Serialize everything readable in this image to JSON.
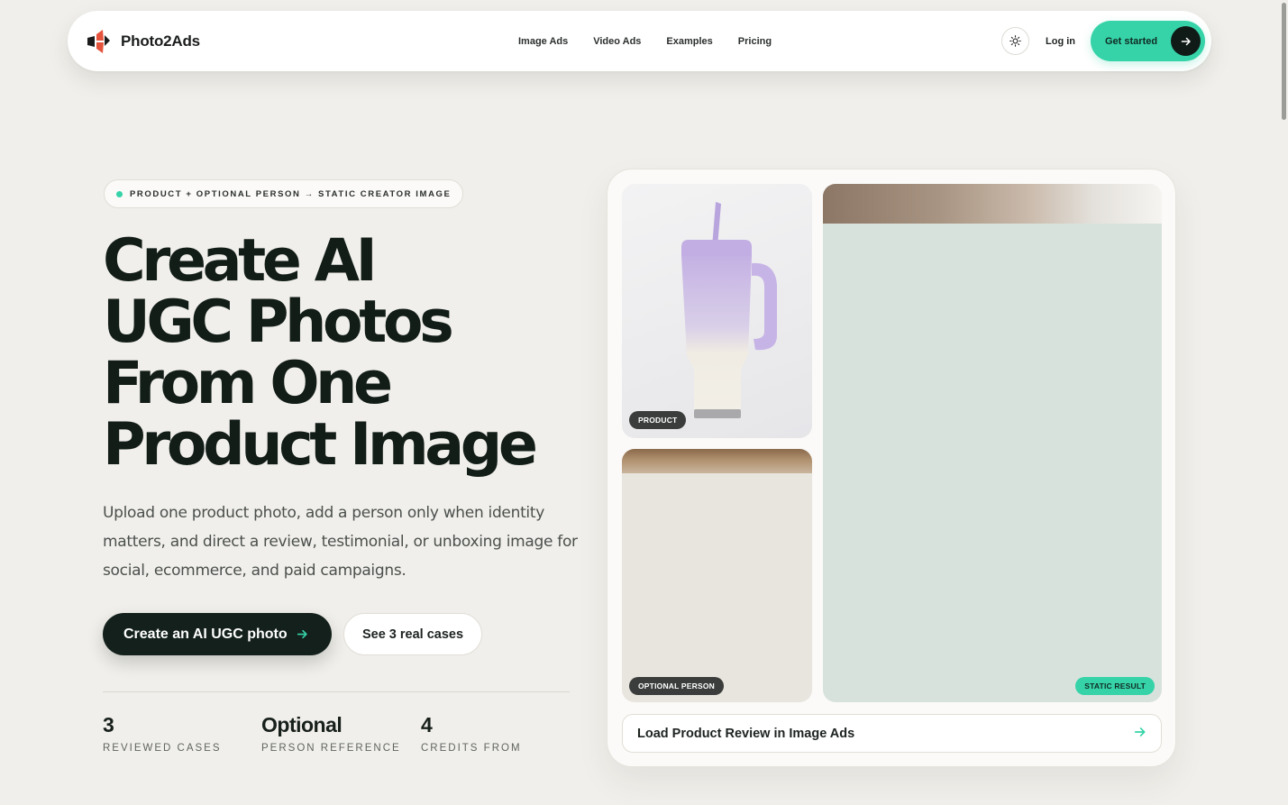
{
  "nav": {
    "brand": "Photo2Ads",
    "links": [
      "Image Ads",
      "Video Ads",
      "Examples",
      "Pricing"
    ],
    "login": "Log in",
    "get_started": "Get started"
  },
  "hero": {
    "eyebrow": "PRODUCT + OPTIONAL PERSON → STATIC CREATOR IMAGE",
    "headline": [
      "Create AI",
      "UGC Photos",
      "From One",
      "Product Image"
    ],
    "subhead": "Upload one product photo, add a person only when identity matters, and direct a review, testimonial, or unboxing image for social, ecommerce, and paid campaigns.",
    "primary_cta": "Create an AI UGC photo",
    "secondary_cta": "See 3 real cases",
    "stats": [
      {
        "value": "3",
        "label": "REVIEWED CASES"
      },
      {
        "value": "Optional",
        "label": "PERSON REFERENCE"
      },
      {
        "value": "4",
        "label": "CREDITS FROM"
      }
    ]
  },
  "showcase": {
    "product_tag": "PRODUCT",
    "person_tag": "OPTIONAL PERSON",
    "result_tag": "STATIC RESULT",
    "load_button": "Load Product Review in Image Ads"
  },
  "colors": {
    "accent": "#36d3a9",
    "dark": "#13201b",
    "background": "#f1efeb"
  },
  "icons": {
    "brand": "brand-logo-icon",
    "theme": "sun-icon",
    "arrow": "arrow-right-icon"
  }
}
